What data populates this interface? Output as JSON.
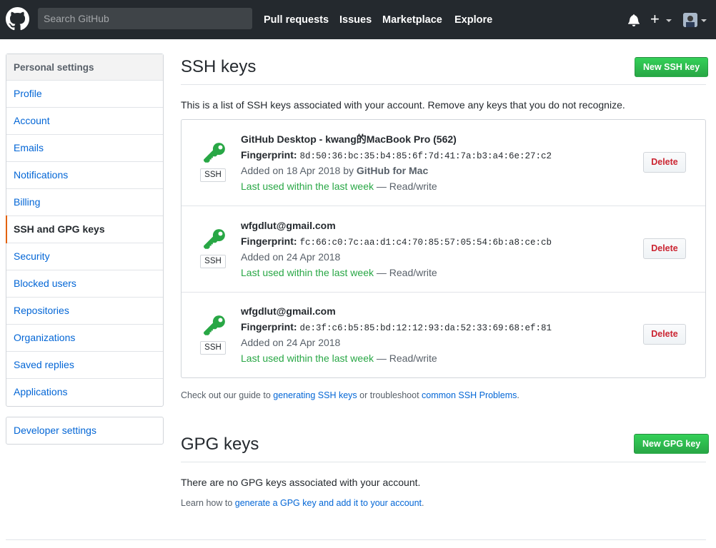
{
  "header": {
    "search_placeholder": "Search GitHub",
    "nav": [
      "Pull requests",
      "Issues",
      "Marketplace",
      "Explore"
    ],
    "plus_label": "+",
    "icons": [
      "github-logo",
      "bell-icon",
      "plus-icon",
      "avatar"
    ]
  },
  "sidebar": {
    "heading": "Personal settings",
    "items": [
      {
        "label": "Profile"
      },
      {
        "label": "Account"
      },
      {
        "label": "Emails"
      },
      {
        "label": "Notifications"
      },
      {
        "label": "Billing"
      },
      {
        "label": "SSH and GPG keys",
        "selected": true
      },
      {
        "label": "Security"
      },
      {
        "label": "Blocked users"
      },
      {
        "label": "Repositories"
      },
      {
        "label": "Organizations"
      },
      {
        "label": "Saved replies"
      },
      {
        "label": "Applications"
      }
    ],
    "developer": "Developer settings"
  },
  "ssh": {
    "title": "SSH keys",
    "new_button": "New SSH key",
    "intro": "This is a list of SSH keys associated with your account. Remove any keys that you do not recognize.",
    "keys": [
      {
        "title": "GitHub Desktop - kwang的MacBook Pro (562)",
        "fingerprint_label": "Fingerprint:",
        "fingerprint": "8d:50:36:bc:35:b4:85:6f:7d:41:7a:b3:a4:6e:27:c2",
        "added": "Added on 18 Apr 2018 by ",
        "added_by": "GitHub for Mac",
        "last_used": "Last used within the last week",
        "access": " — Read/write",
        "badge": "SSH",
        "delete": "Delete"
      },
      {
        "title": "wfgdlut@gmail.com",
        "fingerprint_label": "Fingerprint:",
        "fingerprint": "fc:66:c0:7c:aa:d1:c4:70:85:57:05:54:6b:a8:ce:cb",
        "added": "Added on 24 Apr 2018",
        "added_by": "",
        "last_used": "Last used within the last week",
        "access": " — Read/write",
        "badge": "SSH",
        "delete": "Delete"
      },
      {
        "title": "wfgdlut@gmail.com",
        "fingerprint_label": "Fingerprint:",
        "fingerprint": "de:3f:c6:b5:85:bd:12:12:93:da:52:33:69:68:ef:81",
        "added": "Added on 24 Apr 2018",
        "added_by": "",
        "last_used": "Last used within the last week",
        "access": " — Read/write",
        "badge": "SSH",
        "delete": "Delete"
      }
    ],
    "guide_prefix": "Check out our guide to ",
    "guide_link": "generating SSH keys",
    "guide_middle": " or troubleshoot ",
    "guide_link2": "common SSH Problems",
    "guide_suffix": "."
  },
  "gpg": {
    "title": "GPG keys",
    "new_button": "New GPG key",
    "empty": "There are no GPG keys associated with your account.",
    "learn_prefix": "Learn how to ",
    "learn_link": "generate a GPG key and add it to your account",
    "learn_suffix": "."
  },
  "colors": {
    "header_bg": "#24292e",
    "link": "#0366d6",
    "green": "#28a745",
    "danger": "#cb2431",
    "selected_marker": "#e36209"
  }
}
